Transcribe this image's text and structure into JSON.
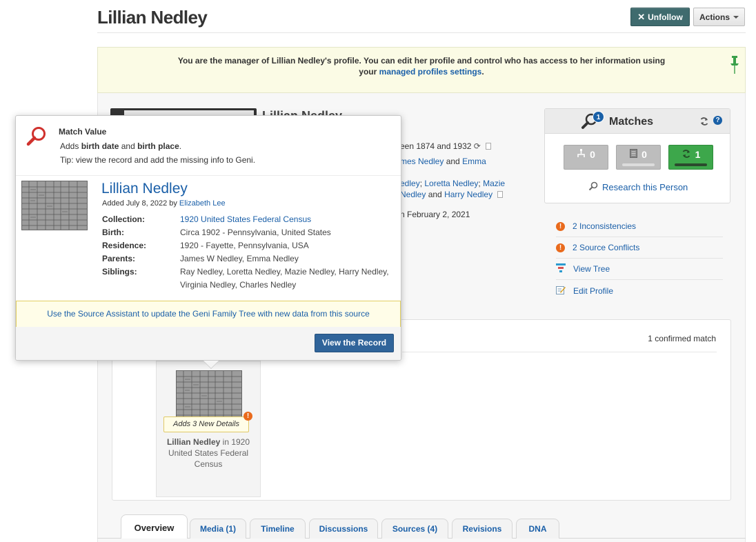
{
  "header": {
    "title": "Lillian Nedley",
    "unfollow_label": "Unfollow",
    "actions_label": "Actions"
  },
  "notice": {
    "text_line1": "You are the manager of Lillian Nedley's profile. You can edit her profile and control who has access to her information using",
    "text_prefix": "your",
    "link": "managed profiles settings",
    "text_suffix": "."
  },
  "profile_bg": {
    "name": "Lillian Nedley",
    "dates": "een 1874 and 1932",
    "parents_link1": "mes Nedley",
    "parents_and": "and",
    "parents_link2": "Emma",
    "siblings_l1_link1": "edley",
    "siblings_l1_link2": "Loretta Nedley",
    "siblings_l1_link3": "Mazie",
    "siblings_l2_link1": "Nedley",
    "siblings_l2_and": "and",
    "siblings_l2_link2": "Harry Nedley",
    "updated": "n February 2, 2021"
  },
  "matches": {
    "title": "Matches",
    "badge": "1",
    "help": "?",
    "tree_count": "0",
    "record_count": "0",
    "confirmed_count": "1",
    "research_label": "Research this Person"
  },
  "side_links": [
    {
      "label": "2 Inconsistencies"
    },
    {
      "label": "2 Source Conflicts"
    },
    {
      "label": "View Tree"
    },
    {
      "label": "Edit Profile"
    }
  ],
  "lower": {
    "confirmed": "1 confirmed match",
    "card_tag": "Adds 3 New Details",
    "card_name": "Lillian Nedley",
    "card_rest": "in 1920 United States Federal Census"
  },
  "popover": {
    "match_value_title": "Match Value",
    "adds_prefix": "Adds",
    "adds_item1": "birth date",
    "adds_and": "and",
    "adds_item2": "birth place",
    "adds_suffix": ".",
    "tip": "Tip: view the record and add the missing info to Geni.",
    "record_name": "Lillian Nedley",
    "added_prefix": "Added July 8, 2022 by",
    "added_by": "Elizabeth Lee",
    "rows": [
      {
        "key": "Collection:",
        "value": "1920 United States Federal Census"
      },
      {
        "key": "Birth:",
        "value": "Circa 1902 - Pennsylvania, United States"
      },
      {
        "key": "Residence:",
        "value": "1920 - Fayette, Pennsylvania, USA"
      },
      {
        "key": "Parents:",
        "value": "James W Nedley, Emma Nedley"
      },
      {
        "key": "Siblings:",
        "value": "Ray Nedley, Loretta Nedley, Mazie Nedley, Harry Nedley, Virginia Nedley, Charles Nedley"
      }
    ],
    "assistant": "Use the Source Assistant to update the Geni Family Tree with new data from this source",
    "view_record": "View the Record"
  },
  "tabs": [
    {
      "label": "Overview"
    },
    {
      "label": "Media (1)"
    },
    {
      "label": "Timeline"
    },
    {
      "label": "Discussions"
    },
    {
      "label": "Sources (4)"
    },
    {
      "label": "Revisions"
    },
    {
      "label": "DNA"
    }
  ],
  "colors": {
    "link": "#1a5fa8",
    "unfollow_bg": "#3f6b6e",
    "confirmed_green": "#3da74b",
    "warning_orange": "#e96a1c",
    "notice_bg": "#fbfbe5",
    "view_button": "#30649a"
  },
  "icons": {
    "unfollow": "close-icon",
    "actions": "chevron-down-icon",
    "pin": "pin-icon",
    "matches": "search-icon",
    "refresh": "refresh-icon",
    "tree_match": "tree-icon",
    "record_match": "document-icon",
    "confirmed_match": "refresh-icon",
    "warning": "warning-icon",
    "view_tree": "tree-icon",
    "edit_profile": "edit-icon"
  }
}
